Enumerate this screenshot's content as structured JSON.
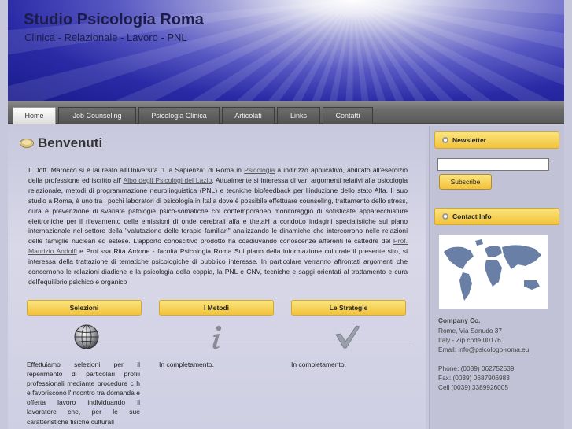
{
  "header": {
    "title": "Studio Psicologia Roma",
    "subtitle": "Clinica - Relazionale - Lavoro - PNL"
  },
  "nav": {
    "items": [
      "Home",
      "Job Counseling",
      "Psicologia Clinica",
      "Articolati",
      "Links",
      "Contatti"
    ],
    "active": "Home"
  },
  "main": {
    "welcome_title": "Benvenuti",
    "intro": {
      "p1": "Il Dott. Marocco si è laureato all'Università \"L a Sapienza\" di Roma in ",
      "link1": "Psicologia",
      "p2": " a indirizzo applicativo, abilitato all'esercizio della professione ed iscritto all' ",
      "link2": "Albo degli Psicologi del Lazio",
      "p3": ". Attualmente si interessa di vari argomenti relativi alla psicologia relazionale, metodi di programmazione neurolinguistica (PNL) e tecniche biofeedback per l'induzione dello stato Alfa. Il suo studio a Roma, è uno tra i pochi laboratori di psicologia in Italia dove è possibile effettuare counseling, trattamento dello stress, cura e prevenzione di svariate patologie psico-somatiche col contemporaneo monitoraggio di sofisticate apparecchiature elettroniche per il rilevamento delle emissioni di onde cerebrali alfa e thetaH a condotto indagini specialistiche sul piano internazionale nel settore della \"valutazione delle terapie familiari\" analizzando le dinamiche che intercorrono nelle relazioni delle famiglie nucleari ed estese. L'apporto conoscitivo prodotto ha coadiuvando conoscenze afferenti le cattedre del ",
      "link3": "Prof. Maurizio Andolfi",
      "p4": " e Prof.ssa Rita Ardone - facoltà Psicologia Roma Sul piano della informazione culturale il presente sito, si interessa della trattazione di tematiche psicologiche di pubblico interesse. In particolare verranno affrontati argomenti che concernono le relazioni diadiche e la psicologia della coppia, la PNL e CNV, tecniche e saggi orientati al trattamento e cura dell'equilibrio psichico e organico"
    },
    "columns": [
      {
        "button": "Selezioni",
        "icon": "globe-icon",
        "text": "Effettuiamo selezioni per il reperimento di particolari profili professionali mediante procedure c h e favoriscono l'incontro tra domanda e offerta lavoro individuando il lavoratore che, per le sue caratteristiche fisiche culturali"
      },
      {
        "button": "I Metodi",
        "icon": "info-icon",
        "text": "In completamento."
      },
      {
        "button": "Le Strategie",
        "icon": "checkmark-icon",
        "text": "In completamento."
      }
    ]
  },
  "sidebar": {
    "newsletter": {
      "title": "Newsletter",
      "input_value": "",
      "button": "Subscribe"
    },
    "contact": {
      "title": "Contact Info",
      "company": "Company Co.",
      "address1": "Rome, Via Sanudo 37",
      "address2": "Italy - Zip code 00176",
      "email_label": "Email: ",
      "email": "info@psicologo-roma.eu",
      "phone": "Phone: (0039) 062752539",
      "fax": "Fax: (0039) 0687906983",
      "cell": "Cell (0039) 3389926005"
    }
  },
  "colors": {
    "accent_yellow": "#f5c842",
    "header_blue": "#2a2aa6",
    "nav_gray": "#6c6c6c"
  }
}
